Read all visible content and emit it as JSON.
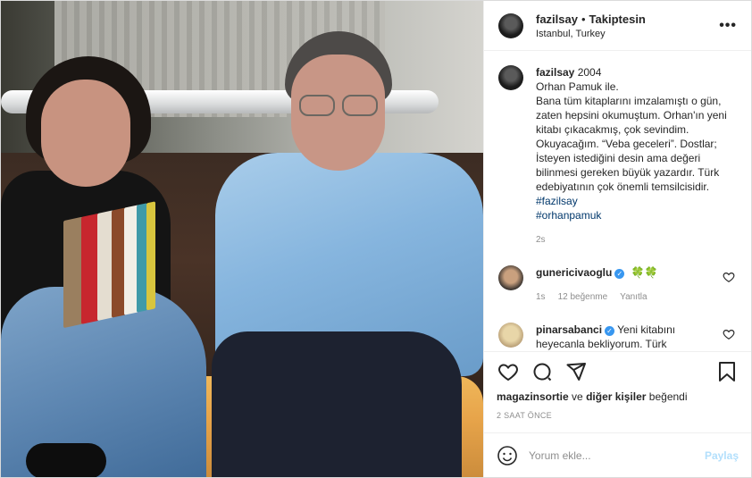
{
  "post": {
    "author": {
      "username": "fazilsay",
      "follow_status": "Takiptesin",
      "location": "Istanbul, Turkey"
    },
    "caption": {
      "username": "fazilsay",
      "year": "2004",
      "text": "Orhan Pamuk ile.\nBana tüm kitaplarını imzalamıştı o gün, zaten hepsini okumuştum. Orhan'ın yeni kitabı çıkacakmış, çok sevindim. Okuyacağım. “Veba geceleri”. Dostlar; İsteyen istediğini desin ama değeri bilinmesi gereken büyük yazardır. Türk edebiyatının çok önemli temsilcisidir.",
      "hashtags": [
        "#fazilsay",
        "#orhanpamuk"
      ],
      "time": "2s"
    },
    "comments": [
      {
        "username": "gunericivaoglu",
        "verified": true,
        "text": "🍀🍀",
        "time": "1s",
        "likes": "12 beğenme",
        "reply": "Yanıtla"
      },
      {
        "username": "pinarsabanci",
        "verified": true,
        "text": "Yeni kitabını heyecanla bekliyorum. Türk"
      }
    ],
    "likes_text": {
      "first_user": "magazinsortie",
      "connector": "ve",
      "others": "diğer kişiler",
      "suffix": "beğendi"
    },
    "posted_ago": "2 SAAT ÖNCE",
    "comment_input": {
      "placeholder": "Yorum ekle...",
      "value": ""
    },
    "share_label": "Paylaş"
  },
  "icons": {
    "more": "more-options-icon",
    "like": "heart-icon",
    "comment": "comment-icon",
    "share": "paper-plane-icon",
    "save": "bookmark-icon",
    "emoji": "emoji-icon"
  },
  "colors": {
    "text": "#262626",
    "muted": "#8e8e8e",
    "link": "#00376b",
    "verified": "#3897f0",
    "share_disabled": "#b2dffc",
    "border": "#dbdbdb"
  }
}
